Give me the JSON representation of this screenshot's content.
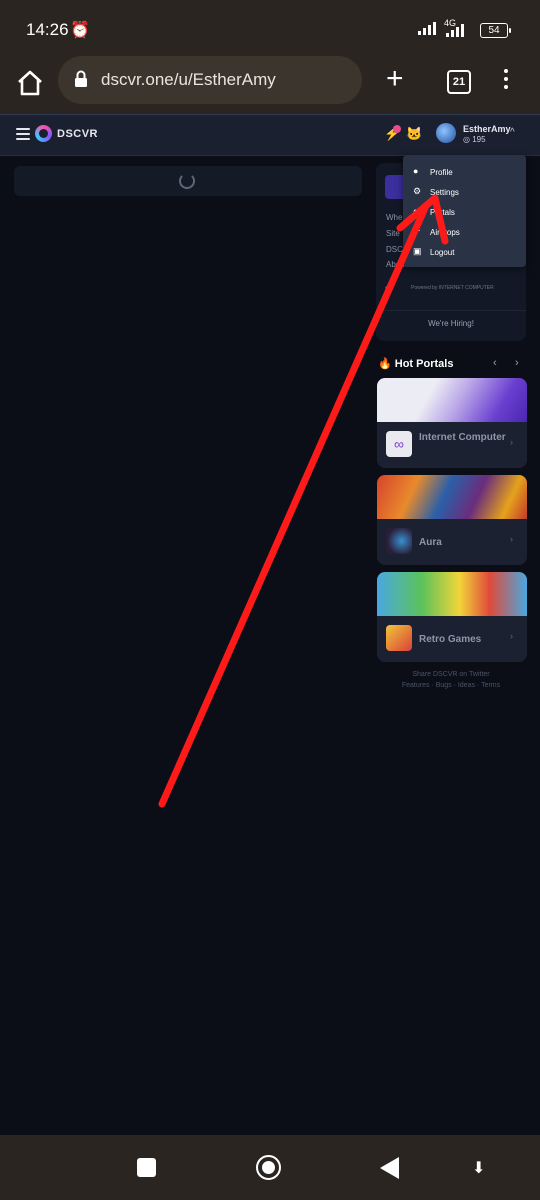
{
  "status_bar": {
    "time": "14:26",
    "network": "4G",
    "battery": "54"
  },
  "browser": {
    "url": "dscvr.one/u/EstherAmy",
    "tab_count": "21"
  },
  "app_header": {
    "brand": "DSCVR",
    "username": "EstherAmy",
    "points": "195"
  },
  "user_menu": {
    "items": [
      {
        "label": "Profile",
        "icon": "user-icon"
      },
      {
        "label": "Settings",
        "icon": "gear-icon"
      },
      {
        "label": "Portals",
        "icon": "portal-icon"
      },
      {
        "label": "Airdrops",
        "icon": "airdrop-icon"
      },
      {
        "label": "Logout",
        "icon": "logout-icon"
      }
    ]
  },
  "sidebar": {
    "links": [
      "Whe",
      "Site",
      "DSCV",
      "Abou"
    ],
    "powered_by": "Powered by INTERNET COMPUTER",
    "hiring": "We're Hiring!"
  },
  "hot_portals": {
    "title": "Hot Portals",
    "portals": [
      {
        "name": "Internet Computer"
      },
      {
        "name": "Aura"
      },
      {
        "name": "Retro Games"
      }
    ]
  },
  "footer": {
    "line1": "Share DSCVR on Twitter",
    "line2": "Features · Bugs · Ideas · Terms"
  },
  "annotation": {
    "color": "#ff1a1a"
  }
}
